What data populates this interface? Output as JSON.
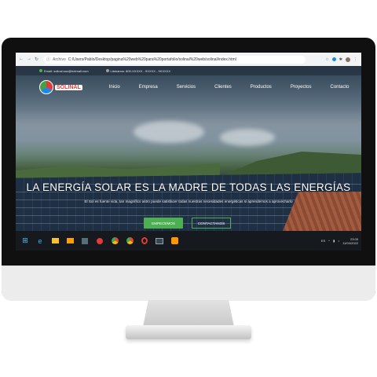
{
  "browser": {
    "address_label": "Archivo",
    "url": "C:/Users/Pablo/Desktop/pagina%20web%20para%20portafolio/solinal%20web/solinal/index.html"
  },
  "site": {
    "logo_text": "SOLINAL",
    "contact": {
      "email": "Email: solinal.sac@hotmail.com",
      "phone": "Llámanos: 809-XXXXX - 9XXXX - 9XXXXX"
    },
    "menu": [
      "Inicio",
      "Empresa",
      "Servicios",
      "Clientes",
      "Productos",
      "Proyectos",
      "Contacto"
    ],
    "hero": {
      "title": "LA ENERGÍA SOLAR ES LA MADRE DE TODAS LAS ENERGÍAS",
      "subtitle": "El Sol es fuente vida, tan magnífico astro puede satisfacer todas nuestras necesidades energéticas si aprendemos a aprovecharlo",
      "primary_button": "EMPECEMOS",
      "secondary_button": "CONTACTANOS"
    },
    "colors": {
      "accent": "#4caf50"
    }
  },
  "taskbar": {
    "icons": [
      "windows-start-icon",
      "edge-icon",
      "file-explorer-icon",
      "folder-icon",
      "media-icon",
      "app-icon",
      "chrome-icon",
      "chrome-icon",
      "opera-icon",
      "terminal-icon",
      "sublime-icon"
    ],
    "clock": {
      "time": "23:05",
      "date": "11/04/2022"
    },
    "language": "ES"
  }
}
